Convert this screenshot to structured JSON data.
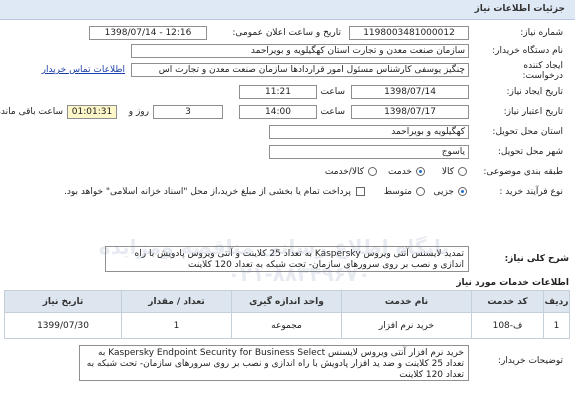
{
  "header": {
    "title": "جزئیات اطلاعات نیاز"
  },
  "form": {
    "need_number_label": "شماره نیاز:",
    "need_number": "1198003481000012",
    "announce_label": "تاریخ و ساعت اعلان عمومی:",
    "announce_value": "1398/07/14 - 12:16",
    "buyer_label": "نام دستگاه خریدار:",
    "buyer_value": "سازمان صنعت معدن و تجارت استان کهگیلویه و بویراحمد",
    "creator_label": "ایجاد کننده درخواست:",
    "creator_value": "چنگیز یوسفی کارشناس مسئول امور قراردادها سازمان صنعت معدن و تجارت اس",
    "contact_link": "اطلاعات تماس خریدار",
    "creation_date_label": "تاریخ ایجاد نیاز:",
    "creation_date": "1398/07/14",
    "creation_time_label": "ساعت",
    "creation_time": "11:21",
    "deadline_label": "تاریخ اعتبار نیاز:",
    "deadline_date": "1398/07/17",
    "deadline_time_label": "ساعت",
    "deadline_time": "14:00",
    "days_value": "3",
    "days_label": "روز و",
    "remaining_time": "01:01:31",
    "remaining_label": "ساعت باقی مانده",
    "province_label": "استان محل تحویل:",
    "province_value": "کهگیلویه و بویراحمد",
    "city_label": "شهر محل تحویل:",
    "city_value": "یاسوج",
    "category_label": "طبقه بندی موضوعی:",
    "category_options": [
      "کالا",
      "خدمت",
      "کالا/خدمت"
    ],
    "category_selected": 1,
    "purchase_label": "نوع فرآیند خرید :",
    "purchase_options": [
      "جزیی",
      "متوسط"
    ],
    "purchase_selected": 0,
    "payment_note": "پرداخت تمام یا بخشی از مبلغ خرید،از محل \"اسناد خزانه اسلامی\" خواهد بود."
  },
  "summary": {
    "label": "شرح کلی نیاز:",
    "text": "تمدید لایسنس آنتی ویروس Kaspersky  به تعداد 25 کلاینت و آنتی ویروس پادویش با راه اندازی و نصب بر روی سرورهای سازمان- تحت شبکه به تعداد 120 کلاینت"
  },
  "services": {
    "title": "اطلاعات خدمات مورد نیاز",
    "columns": [
      "ردیف",
      "کد خدمت",
      "نام خدمت",
      "واحد اندازه گیری",
      "تعداد / مقدار",
      "تاریخ نیاز"
    ],
    "rows": [
      [
        "1",
        "ف-108",
        "خرید نرم افزار",
        "مجموعه",
        "1",
        "1399/07/30"
      ]
    ]
  },
  "buyer_notes": {
    "label": "توضیحات خریدار:",
    "text": "خرید نرم افزار آنتی ویروس لایسنس Kaspersky Endpoint Security for Business Select به تعداد 25 کلاینت و ضد ید افزار پادویش با راه اندازی و نصب بر روی سرورهای سازمان- تحت شبکه به تعداد 120 کلاینت"
  },
  "watermark": {
    "line1": "پایگاه اطلاع رسانی مناقصه ومزایده",
    "line2": "۰۲۱-۸۸۳۴۹۶۷۰"
  }
}
